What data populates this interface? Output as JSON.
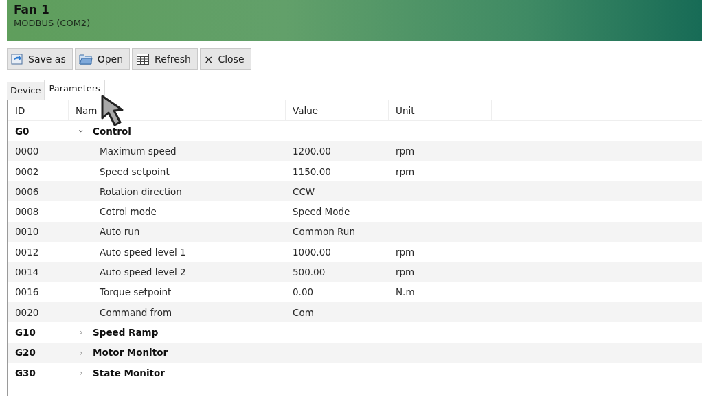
{
  "window": {
    "title": "Fan 1",
    "subtitle": "MODBUS (COM2)"
  },
  "toolbar": [
    {
      "kind": "save",
      "label": "Save as"
    },
    {
      "kind": "open",
      "label": "Open"
    },
    {
      "kind": "refresh",
      "label": "Refresh"
    },
    {
      "kind": "close",
      "label": "Close",
      "icon": "×"
    }
  ],
  "tabs": [
    {
      "label": "Device",
      "selected": false
    },
    {
      "label": "Parameters",
      "selected": true
    }
  ],
  "table": {
    "columns": [
      "ID",
      "Nam",
      "Value",
      "Unit"
    ],
    "groups": [
      {
        "id": "G0",
        "name": "Control",
        "expanded": true,
        "chevron": "›",
        "children": [
          {
            "id": "0000",
            "name": "Maximum speed",
            "value": "1200.00",
            "unit": "rpm"
          },
          {
            "id": "0002",
            "name": "Speed setpoint",
            "value": "1150.00",
            "unit": "rpm"
          },
          {
            "id": "0006",
            "name": "Rotation direction",
            "value": "CCW"
          },
          {
            "id": "0008",
            "name": "Cotrol mode",
            "value": "Speed Mode"
          },
          {
            "id": "0010",
            "name": "Auto run",
            "value": "Common Run"
          },
          {
            "id": "0012",
            "name": "Auto speed level 1",
            "value": "1000.00",
            "unit": "rpm"
          },
          {
            "id": "0014",
            "name": "Auto speed level 2",
            "value": "500.00",
            "unit": "rpm"
          },
          {
            "id": "0016",
            "name": "Torque setpoint",
            "value": "0.00",
            "unit": "N.m"
          },
          {
            "id": "0020",
            "name": "Command from",
            "value": "Com"
          }
        ]
      },
      {
        "id": "G10",
        "name": "Speed Ramp",
        "expanded": false,
        "chevron": "›"
      },
      {
        "id": "G20",
        "name": "Motor Monitor",
        "expanded": false,
        "chevron": "›"
      },
      {
        "id": "G30",
        "name": "State Monitor",
        "expanded": false,
        "chevron": "›"
      }
    ]
  }
}
